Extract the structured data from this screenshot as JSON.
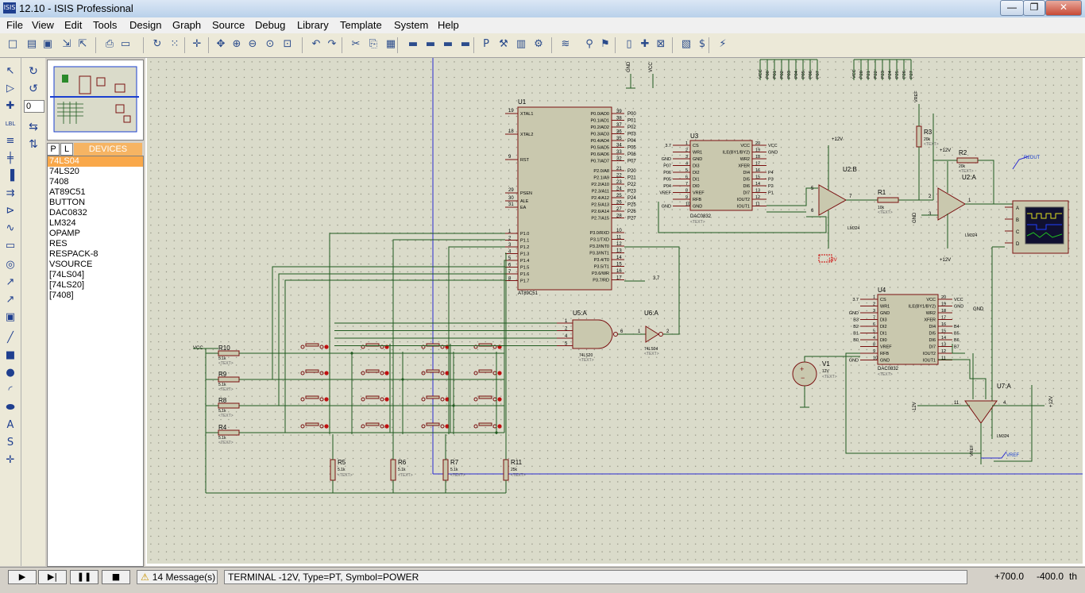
{
  "window": {
    "title": "12.10 - ISIS Professional",
    "app_icon_text": "ISIS",
    "controls": {
      "minimize": "—",
      "maximize": "❐",
      "close": "✕"
    }
  },
  "menu": [
    "File",
    "View",
    "Edit",
    "Tools",
    "Design",
    "Graph",
    "Source",
    "Debug",
    "Library",
    "Template",
    "System",
    "Help"
  ],
  "toolbar_icons": [
    "new-icon",
    "open-icon",
    "save-icon",
    "import-icon",
    "export-icon",
    "print-icon",
    "set-area-icon",
    "refresh-icon",
    "grid-icon",
    "origin-icon",
    "pan-icon",
    "zoom-in-icon",
    "zoom-out-icon",
    "zoom-all-icon",
    "zoom-area-icon",
    "undo-icon",
    "redo-icon",
    "cut-icon",
    "copy-icon",
    "paste-icon",
    "block-copy-icon",
    "block-move-icon",
    "block-rotate-icon",
    "block-delete-icon",
    "pick-device-icon",
    "make-device-icon",
    "package-icon",
    "decompose-icon",
    "wire-autorouter-icon",
    "search-icon",
    "property-assign-icon",
    "new-sheet-icon",
    "remove-sheet-icon",
    "goto-sheet-icon",
    "bill-of-materials-icon",
    "electrical-rule-icon",
    "netlist-to-ares-icon"
  ],
  "toolbar_glyphs": [
    "□",
    "▤",
    "▣",
    "⇲",
    "⇱",
    "⎙",
    "▭",
    "↻",
    "⁙",
    "✛",
    "✥",
    "⊕",
    "⊖",
    "⊙",
    "⊡",
    "↶",
    "↷",
    "✂",
    "⎘",
    "▦",
    "▬",
    "▬",
    "▬",
    "▬",
    "P",
    "⚒",
    "▥",
    "⚙",
    "≋",
    "⚲",
    "⚑",
    "▯",
    "✚",
    "⊠",
    "▧",
    "$",
    "⚡"
  ],
  "left_tools": [
    {
      "name": "selection-mode-icon",
      "glyph": "↖"
    },
    {
      "name": "component-mode-icon",
      "glyph": "▷"
    },
    {
      "name": "junction-dot-icon",
      "glyph": "✚"
    },
    {
      "name": "wire-label-icon",
      "glyph": "LBL"
    },
    {
      "name": "text-script-icon",
      "glyph": "≡"
    },
    {
      "name": "bus-icon",
      "glyph": "╪"
    },
    {
      "name": "subcircuit-icon",
      "glyph": "▐"
    },
    {
      "name": "terminals-icon",
      "glyph": "⇉"
    },
    {
      "name": "device-pins-icon",
      "glyph": "⊳"
    },
    {
      "name": "graph-icon",
      "glyph": "∿"
    },
    {
      "name": "tape-recorder-icon",
      "glyph": "▭"
    },
    {
      "name": "generator-icon",
      "glyph": "◎"
    },
    {
      "name": "voltage-probe-icon",
      "glyph": "↗"
    },
    {
      "name": "current-probe-icon",
      "glyph": "↗"
    },
    {
      "name": "virtual-instruments-icon",
      "glyph": "▣"
    },
    {
      "name": "line-icon",
      "glyph": "╱"
    },
    {
      "name": "box-icon",
      "glyph": "■"
    },
    {
      "name": "circle-icon",
      "glyph": "●"
    },
    {
      "name": "arc-icon",
      "glyph": "◜"
    },
    {
      "name": "path-icon",
      "glyph": "⬬"
    },
    {
      "name": "text-icon",
      "glyph": "A"
    },
    {
      "name": "symbol-icon",
      "glyph": "S"
    },
    {
      "name": "marker-icon",
      "glyph": "✛"
    }
  ],
  "rotation": {
    "rotate_cw": "↻",
    "rotate_ccw": "↺",
    "angle": "0",
    "mirror_x": "⇆",
    "mirror_y": "⇅"
  },
  "device_selector": {
    "tab_p": "P",
    "tab_l": "L",
    "title": "DEVICES",
    "items": [
      "74LS04",
      "74LS20",
      "7408",
      "AT89C51",
      "BUTTON",
      "DAC0832",
      "LM324",
      "OPAMP",
      "RES",
      "RESPACK-8",
      "VSOURCE",
      "[74LS04]",
      "[74LS20]",
      "[7408]"
    ],
    "selected_index": 0
  },
  "schematic": {
    "u1": {
      "ref": "U1",
      "part": "AT89C51",
      "left_pins": [
        [
          "19",
          "XTAL1"
        ],
        [
          "18",
          "XTAL2"
        ],
        [
          "9",
          "RST"
        ],
        [
          "29",
          "PSEN"
        ],
        [
          "30",
          "ALE"
        ],
        [
          "31",
          "EA"
        ]
      ],
      "p1_pins": [
        [
          "1",
          "P1.0"
        ],
        [
          "2",
          "P1.1"
        ],
        [
          "3",
          "P1.2"
        ],
        [
          "4",
          "P1.3"
        ],
        [
          "5",
          "P1.4"
        ],
        [
          "6",
          "P1.5"
        ],
        [
          "7",
          "P1.6"
        ],
        [
          "8",
          "P1.7"
        ]
      ],
      "p0_pins": [
        [
          "39",
          "P0.0/AD0"
        ],
        [
          "38",
          "P0.1/AD1"
        ],
        [
          "37",
          "P0.2/AD2"
        ],
        [
          "36",
          "P0.3/AD3"
        ],
        [
          "35",
          "P0.4/AD4"
        ],
        [
          "34",
          "P0.5/AD5"
        ],
        [
          "33",
          "P0.6/AD6"
        ],
        [
          "32",
          "P0.7/AD7"
        ]
      ],
      "p2_pins": [
        [
          "21",
          "P2.0/A8"
        ],
        [
          "22",
          "P2.1/A9"
        ],
        [
          "23",
          "P2.2/A10"
        ],
        [
          "24",
          "P2.3/A11"
        ],
        [
          "25",
          "P2.4/A12"
        ],
        [
          "26",
          "P2.5/A13"
        ],
        [
          "27",
          "P2.6/A14"
        ],
        [
          "28",
          "P2.7/A15"
        ]
      ],
      "p3_pins": [
        [
          "10",
          "P3.0/RXD"
        ],
        [
          "11",
          "P3.1/TXD"
        ],
        [
          "12",
          "P3.2/INT0"
        ],
        [
          "13",
          "P3.3/INT1"
        ],
        [
          "14",
          "P3.4/T0"
        ],
        [
          "15",
          "P3.5/T1"
        ],
        [
          "16",
          "P3.6/WR"
        ],
        [
          "17",
          "P3.7/RD"
        ]
      ],
      "p0_labels": [
        "P00",
        "P01",
        "P02",
        "P03",
        "P04",
        "P05",
        "P06",
        "P07"
      ],
      "p2_labels": [
        "P20",
        "P21",
        "P22",
        "P23",
        "P24",
        "P25",
        "P26",
        "P27"
      ],
      "p37": "3.7"
    },
    "u3": {
      "ref": "U3",
      "part": "DAC0832",
      "text": "<TEXT>",
      "left_pins": [
        [
          "3.7",
          "1",
          "CS"
        ],
        [
          "",
          "2",
          "WR1"
        ],
        [
          "GND",
          "3",
          "GND"
        ],
        [
          "P07",
          "4",
          "DI3"
        ],
        [
          "P06",
          "5",
          "DI2"
        ],
        [
          "P05",
          "6",
          "DI1"
        ],
        [
          "P04",
          "7",
          "DI0"
        ],
        [
          "VREF",
          "8",
          "VREF"
        ],
        [
          "",
          "9",
          "RFB"
        ],
        [
          "GND",
          "10",
          "GND"
        ]
      ],
      "right_pins": [
        [
          "20",
          "VCC"
        ],
        [
          "19",
          "ILE(BY1/BY2)"
        ],
        [
          "18",
          "WR2"
        ],
        [
          "17",
          "XFER"
        ],
        [
          "16",
          "DI4"
        ],
        [
          "15",
          "DI5"
        ],
        [
          "14",
          "DI6"
        ],
        [
          "13",
          "DI7"
        ],
        [
          "12",
          "IOUT2"
        ],
        [
          "11",
          "IOUT1"
        ]
      ],
      "right_nets": [
        "VCC",
        "GND",
        "",
        "",
        "P4",
        "P3",
        "P2",
        "P1",
        "",
        ""
      ]
    },
    "u4": {
      "ref": "U4",
      "part": "DAC0832",
      "text": "<TEXT>",
      "left_pins": [
        [
          "3.7",
          "1",
          "CS"
        ],
        [
          "",
          "2",
          "WR1"
        ],
        [
          "GND",
          "3",
          "GND"
        ],
        [
          "B3",
          "7",
          "DI3"
        ],
        [
          "B2",
          "6",
          "DI2"
        ],
        [
          "B1",
          "5",
          "DI1"
        ],
        [
          "B0",
          "4",
          "DI0"
        ],
        [
          "",
          "8",
          "VREF"
        ],
        [
          "",
          "9",
          "RFB"
        ],
        [
          "GND",
          "10",
          "GND"
        ]
      ],
      "right_pins": [
        [
          "20",
          "VCC"
        ],
        [
          "19",
          "ILE(BY1/BY2)"
        ],
        [
          "18",
          "WR2"
        ],
        [
          "17",
          "XFER"
        ],
        [
          "16",
          "DI4"
        ],
        [
          "15",
          "DI5"
        ],
        [
          "14",
          "DI6"
        ],
        [
          "13",
          "DI7"
        ],
        [
          "12",
          "IOUT2"
        ],
        [
          "11",
          "IOUT1"
        ]
      ],
      "right_nets": [
        "VCC",
        "GND",
        "",
        "",
        "B4",
        "B5",
        "B6",
        "B7",
        "",
        ""
      ]
    },
    "u2b": {
      "ref": "U2:B",
      "part": "LM324",
      "text": "<TEXT>",
      "pins": [
        "5",
        "6",
        "7",
        "4",
        "11"
      ],
      "pos_supply": "+12V",
      "neg_supply": "-12V"
    },
    "u2a": {
      "ref": "U2:A",
      "part": "LM324",
      "text": "<TEXT>",
      "pins": [
        "2",
        "3",
        "1",
        "4",
        "11"
      ],
      "pos_supply": "+12V",
      "neg_supply": "+12V"
    },
    "u7a": {
      "ref": "U7:A",
      "part": "LM324",
      "text": "<TEXT>",
      "pins": [
        "11",
        "4",
        "12",
        "13"
      ],
      "neg_supply": "-12V",
      "pos_supply": "+12V",
      "ref_label": "VREF",
      "gnd": "GND"
    },
    "u5a": {
      "ref": "U5:A",
      "part": "74LS20",
      "text": "<TEXT>",
      "pins": [
        "1",
        "2",
        "4",
        "5",
        "6"
      ]
    },
    "u6a": {
      "ref": "U6:A",
      "part": "74LS04",
      "text": "<TEXT>",
      "pins": [
        "1",
        "2"
      ]
    },
    "r1": {
      "ref": "R1",
      "value": "10k",
      "text": "<TEXT>"
    },
    "r2": {
      "ref": "R2",
      "value": "20k",
      "text": "<TEXT>"
    },
    "r3": {
      "ref": "R3",
      "value": "20k",
      "text": "<TEXT>",
      "net": "VREF"
    },
    "v1": {
      "ref": "V1",
      "value": "12V",
      "text": "<TEXT>"
    },
    "row_res": [
      {
        "ref": "R10",
        "value": "5.1k",
        "text": "<TEXT>"
      },
      {
        "ref": "R9",
        "value": "5.1k",
        "text": "<TEXT>"
      },
      {
        "ref": "R8",
        "value": "5.1k",
        "text": "<TEXT>"
      },
      {
        "ref": "R4",
        "value": "5.1k",
        "text": "<TEXT>"
      }
    ],
    "col_res": [
      {
        "ref": "R5",
        "value": "5.1k",
        "text": "<TEXT>"
      },
      {
        "ref": "R6",
        "value": "5.1k",
        "text": "<TEXT>"
      },
      {
        "ref": "R7",
        "value": "5.1k",
        "text": "<TEXT>"
      },
      {
        "ref": "R11",
        "value": "25k",
        "text": "<TEXT>"
      }
    ],
    "vcc_label": "VCC",
    "gnd_label": "GND",
    "top_labels": {
      "gnd": "GND",
      "vcc": "VCC"
    },
    "bus_labels_left": [
      "VCC",
      "P00",
      "P01",
      "P02",
      "P03",
      "P04",
      "P05",
      "P06",
      "P07"
    ],
    "bus_labels_right": [
      "VCC",
      "P20",
      "P21",
      "P22",
      "P23",
      "P24",
      "P25",
      "P26",
      "P27"
    ],
    "probe_labels": {
      "r2out": "R2OUT",
      "vref": "VREF"
    },
    "scope_pins": [
      "A",
      "B",
      "C",
      "D"
    ]
  },
  "status": {
    "play": "▶",
    "step": "▶|",
    "pause": "❚❚",
    "stop": "■",
    "messages": "14 Message(s)",
    "text": "TERMINAL -12V, Type=PT, Symbol=POWER",
    "x": "+700.0",
    "y": "-400.0",
    "units": "th"
  },
  "colors": {
    "wire": "#1f5a1f",
    "component": "#7a1010",
    "fill": "#c9c8ae",
    "sheet_border": "#2a2ad0"
  }
}
